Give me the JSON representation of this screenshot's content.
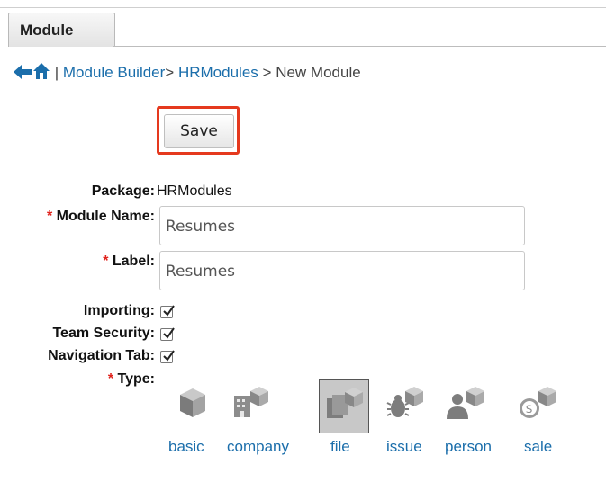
{
  "tab": {
    "label": "Module"
  },
  "breadcrumb": {
    "sep": "|",
    "items": [
      "Module Builder",
      "HRModules",
      "New Module"
    ],
    "arrows": [
      ">",
      ">"
    ]
  },
  "save_label": "Save",
  "form": {
    "package_label": "Package:",
    "package_value": "HRModules",
    "module_name_label": "Module Name:",
    "module_name_value": "Resumes",
    "label_label": "Label:",
    "label_value": "Resumes",
    "importing_label": "Importing:",
    "team_security_label": "Team Security:",
    "navigation_tab_label": "Navigation Tab:",
    "type_label": "Type:",
    "required_mark": "*",
    "importing_checked": true,
    "team_security_checked": true,
    "navigation_tab_checked": true
  },
  "types": [
    "basic",
    "company",
    "file",
    "issue",
    "person",
    "sale"
  ],
  "selected_type": "file",
  "colors": {
    "link": "#1b6eab",
    "required": "#e0221c",
    "highlight": "#e5391e",
    "icon_gray": "#9a9a9a"
  }
}
